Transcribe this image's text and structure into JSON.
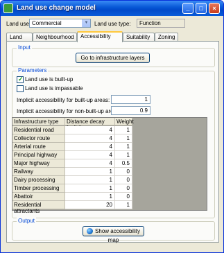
{
  "window": {
    "title": "Land use change model",
    "controls": {
      "minimize": "_",
      "maximize": "□",
      "close": "×"
    }
  },
  "top": {
    "land_use_label": "Land use:",
    "land_use_value": "Commercial",
    "land_use_type_label": "Land use type:",
    "land_use_type_value": "Function"
  },
  "tabs": [
    {
      "label": "Land use"
    },
    {
      "label": "Neighbourhood"
    },
    {
      "label": "Accessibility"
    },
    {
      "label": "Suitability"
    },
    {
      "label": "Zoning"
    }
  ],
  "input_group": {
    "title": "Input",
    "button_label": "Go to infrastructure layers"
  },
  "parameters_group": {
    "title": "Parameters",
    "checkbox_built_up": {
      "label": "Land use is built-up",
      "checked": true
    },
    "checkbox_impassable": {
      "label": "Land use is impassable",
      "checked": false
    },
    "implicit_built_up_label": "Implicit accessibility for built-up areas:",
    "implicit_built_up_value": "1",
    "implicit_non_built_up_label": "Implicit accessibility for non-built-up areas:",
    "implicit_non_built_up_value": "0.9"
  },
  "table": {
    "headers": [
      "Infrastructure type",
      "Distance decay [cells]",
      "Weight"
    ],
    "rows": [
      [
        "Residential road",
        "4",
        "1"
      ],
      [
        "Collector route",
        "4",
        "1"
      ],
      [
        "Arterial route",
        "4",
        "1"
      ],
      [
        "Principal highway",
        "4",
        "1"
      ],
      [
        "Major highway",
        "4",
        "0.5"
      ],
      [
        "Railway",
        "1",
        "0"
      ],
      [
        "Dairy processing",
        "1",
        "0"
      ],
      [
        "Timber processing",
        "1",
        "0"
      ],
      [
        "Abattoir",
        "1",
        "0"
      ],
      [
        "Residential attractants",
        "20",
        "1"
      ]
    ]
  },
  "output_group": {
    "title": "Output",
    "button_label": "Show accessibility map"
  },
  "icons": {
    "app": "app-icon",
    "dropdown": "chevron-down-icon",
    "check": "checkmark-icon",
    "map": "globe-icon"
  }
}
